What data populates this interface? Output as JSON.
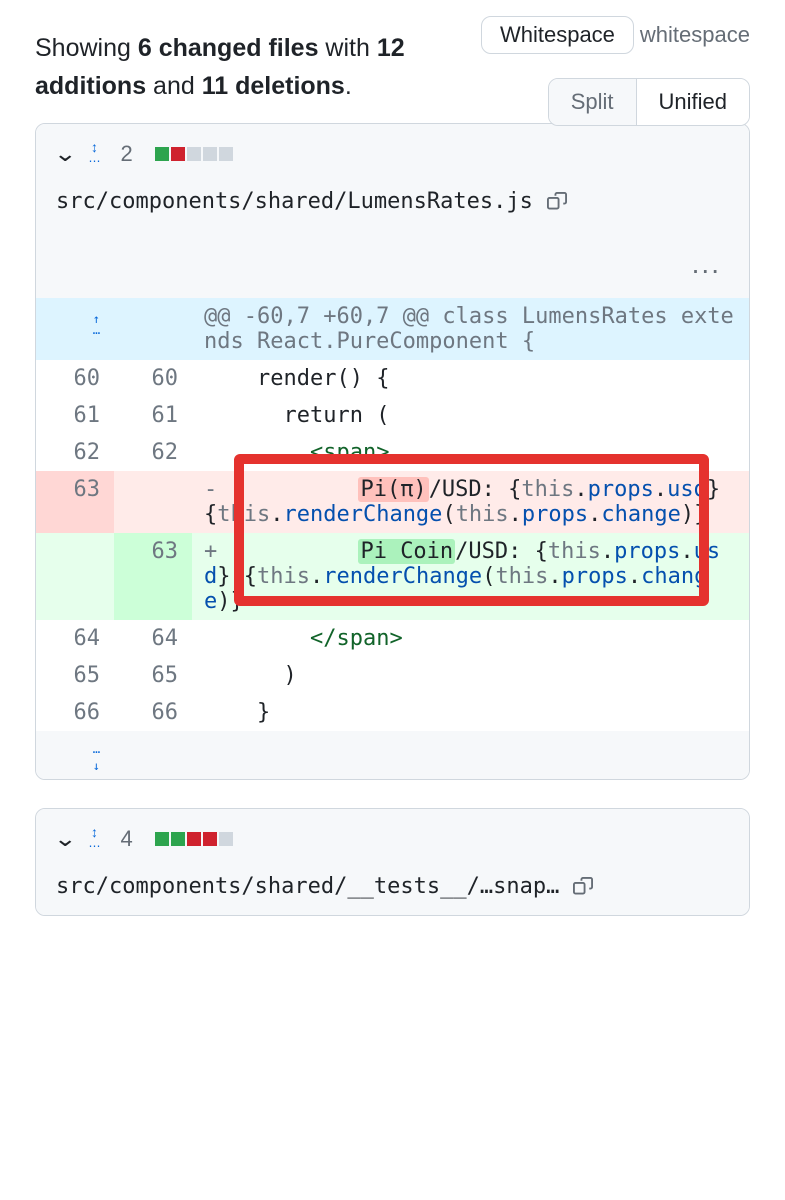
{
  "summary": {
    "prefix": "Showing ",
    "files": "6 changed files",
    "mid": " with ",
    "additions": "12 additions",
    "and": " and ",
    "deletions": "11 deletions",
    "suffix": "."
  },
  "whitespace": {
    "btn": "Whitespace",
    "label": "whitespace"
  },
  "view": {
    "split": "Split",
    "unified": "Unified"
  },
  "file1": {
    "changes": "2",
    "path": "src/components/shared/LumensRates.js",
    "hunk": "@@ -60,7 +60,7 @@ class LumensRates extends React.PureComponent {",
    "rows": [
      {
        "l": "60",
        "r": "60",
        "code": "    render() {"
      },
      {
        "l": "61",
        "r": "61",
        "code": "      return ("
      },
      {
        "l": "62",
        "r": "62",
        "code_html": "        <span class='tok-tag'>&lt;span&gt;</span>"
      },
      {
        "l": "63",
        "r": "",
        "type": "del",
        "code_html": "<span class='marker'>-</span>          <span class='hl-del'>Pi(π)</span>/USD: {<span class='tok-kw'>this</span>.<span class='tok-prop'>props</span>.<span class='tok-prop'>usd</span>} {<span class='tok-kw'>this</span>.<span class='tok-prop'>renderChange</span>(<span class='tok-kw'>this</span>.<span class='tok-prop'>props</span>.<span class='tok-prop'>change</span>)}"
      },
      {
        "l": "",
        "r": "63",
        "type": "add",
        "code_html": "<span class='marker'>+</span>          <span class='hl-add'>Pi Coin</span>/USD: {<span class='tok-kw'>this</span>.<span class='tok-prop'>props</span>.<span class='tok-prop'>usd</span>} {<span class='tok-kw'>this</span>.<span class='tok-prop'>renderChange</span>(<span class='tok-kw'>this</span>.<span class='tok-prop'>props</span>.<span class='tok-prop'>change</span>)}"
      },
      {
        "l": "64",
        "r": "64",
        "code_html": "        <span class='tok-tag'>&lt;/span&gt;</span>"
      },
      {
        "l": "65",
        "r": "65",
        "code": "      )"
      },
      {
        "l": "66",
        "r": "66",
        "code": "    }"
      }
    ]
  },
  "file2": {
    "changes": "4",
    "path": "src/components/shared/__tests__/…snap…"
  },
  "more": "..."
}
